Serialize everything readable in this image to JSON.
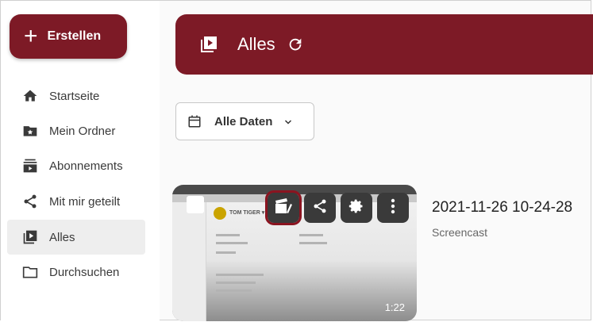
{
  "sidebar": {
    "create_label": "Erstellen",
    "items": [
      {
        "label": "Startseite",
        "icon": "home-icon"
      },
      {
        "label": "Mein Ordner",
        "icon": "folder-star-icon"
      },
      {
        "label": "Abonnements",
        "icon": "subscriptions-icon"
      },
      {
        "label": "Mit mir geteilt",
        "icon": "share-icon"
      },
      {
        "label": "Alles",
        "icon": "video-library-icon",
        "active": true
      },
      {
        "label": "Durchsuchen",
        "icon": "folder-icon"
      }
    ]
  },
  "header": {
    "title": "Alles"
  },
  "filter": {
    "date_label": "Alle Daten"
  },
  "video": {
    "title": "2021-11-26 10-24-28",
    "type": "Screencast",
    "duration": "1:22",
    "thumbnail_brand": "TOM TIGER ▾"
  },
  "colors": {
    "brand": "#7d1a26",
    "active_nav": "#eeeeee",
    "selected_outline": "#8a1420"
  }
}
